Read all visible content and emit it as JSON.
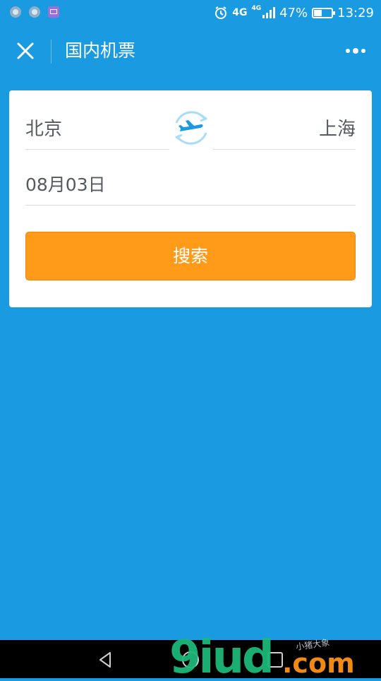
{
  "status_bar": {
    "network_small": "4G",
    "network": "4G",
    "battery": "47%",
    "battery_level": 0.47,
    "time": "13:29",
    "notification_icons": [
      "message-bubble-icon",
      "chat-icon",
      "picture-icon"
    ]
  },
  "nav": {
    "title": "国内机票",
    "close_icon": "close-icon",
    "more_icon": "more-dots-icon"
  },
  "form": {
    "from_city": "北京",
    "to_city": "上海",
    "swap_icon": "plane-swap-icon",
    "date": "08月03日",
    "search_label": "搜索"
  },
  "system_nav": {
    "back_icon": "back-triangle-icon",
    "home_icon": "home-circle-icon",
    "recent_icon": "recent-square-icon"
  },
  "watermark": {
    "text": "9iud.com",
    "subtitle": "小猪大象"
  },
  "colors": {
    "background": "#1a9be1",
    "card": "#ffffff",
    "search_button": "#ff9b18",
    "watermark_green": "#1db87a",
    "watermark_orange": "#f08a14",
    "system_nav": "#000000"
  }
}
